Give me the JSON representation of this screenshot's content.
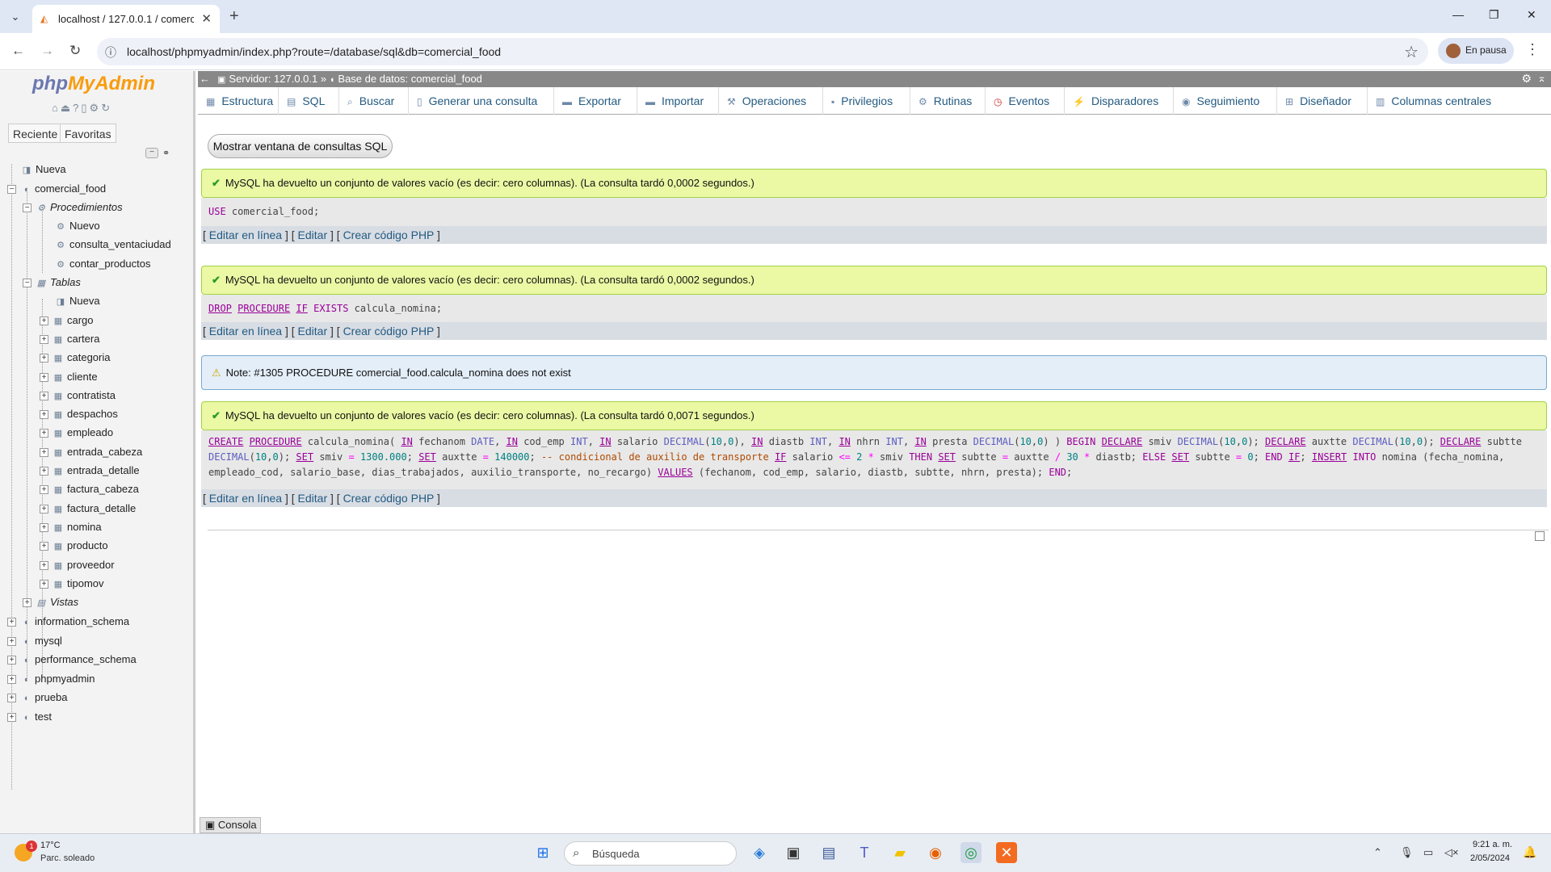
{
  "browser": {
    "tab_title": "localhost / 127.0.0.1 / comercial_food",
    "url": "localhost/phpmyadmin/index.php?route=/database/sql&db=comercial_food",
    "profile_label": "En pausa"
  },
  "sidebar": {
    "logo_php": "php",
    "logo_myadmin": "MyAdmin",
    "tab_recent": "Reciente",
    "tab_favorites": "Favoritas",
    "tree": {
      "new": "Nueva",
      "db": "comercial_food",
      "procedures": "Procedimientos",
      "proc_items": [
        "Nuevo",
        "consulta_ventaciudad",
        "contar_productos"
      ],
      "tables": "Tablas",
      "tables_new": "Nueva",
      "table_items": [
        "cargo",
        "cartera",
        "categoria",
        "cliente",
        "contratista",
        "despachos",
        "empleado",
        "entrada_cabeza",
        "entrada_detalle",
        "factura_cabeza",
        "factura_detalle",
        "nomina",
        "producto",
        "proveedor",
        "tipomov"
      ],
      "views": "Vistas",
      "other_dbs": [
        "information_schema",
        "mysql",
        "performance_schema",
        "phpmyadmin",
        "prueba",
        "test"
      ]
    }
  },
  "main": {
    "breadcrumb": {
      "server": "Servidor: 127.0.0.1",
      "sep": "»",
      "database": "Base de datos: comercial_food"
    },
    "tabs": [
      "Estructura",
      "SQL",
      "Buscar",
      "Generar una consulta",
      "Exportar",
      "Importar",
      "Operaciones",
      "Privilegios",
      "Rutinas",
      "Eventos",
      "Disparadores",
      "Seguimiento",
      "Diseñador",
      "Columnas centrales"
    ],
    "show_sql_button": "Mostrar ventana de consultas SQL",
    "msg1": "MySQL ha devuelto un conjunto de valores vacío (es decir: cero columnas). (La consulta tardó 0,0002 segundos.)",
    "msg2": "MySQL ha devuelto un conjunto de valores vacío (es decir: cero columnas). (La consulta tardó 0,0002 segundos.)",
    "msg3": "MySQL ha devuelto un conjunto de valores vacío (es decir: cero columnas). (La consulta tardó 0,0071 segundos.)",
    "note": "Note: #1305 PROCEDURE comercial_food.calcula_nomina does not exist",
    "links": {
      "inline": "Editar en línea",
      "edit": "Editar",
      "php": "Crear código PHP"
    },
    "console": "Consola"
  },
  "taskbar": {
    "temp": "17°C",
    "weather": "Parc. soleado",
    "search": "Búsqueda",
    "time": "9:21 a. m.",
    "date": "2/05/2024",
    "badge": "1"
  }
}
